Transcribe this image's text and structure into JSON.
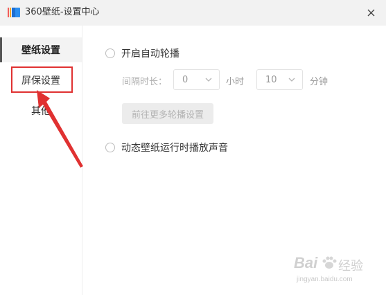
{
  "window": {
    "title": "360壁纸-设置中心"
  },
  "sidebar": {
    "items": [
      {
        "label": "壁纸设置",
        "active": true
      },
      {
        "label": "屏保设置",
        "active": false
      },
      {
        "label": "其他",
        "active": false
      }
    ]
  },
  "settings": {
    "auto_rotate": {
      "label": "开启自动轮播",
      "checked": false
    },
    "interval": {
      "label": "间隔时长：",
      "hours": {
        "value": "0",
        "unit": "小时"
      },
      "minutes": {
        "value": "10",
        "unit": "分钟"
      }
    },
    "more_rotate_button": "前往更多轮播设置",
    "dynamic_sound": {
      "label": "动态壁纸运行时播放声音",
      "checked": false
    }
  },
  "watermark": {
    "brand": "Bai",
    "brand_suffix": "经验",
    "url": "jingyan.baidu.com"
  },
  "colors": {
    "highlight": "#e03131",
    "arrow": "#e03131",
    "titlebar": "#f2f2f2"
  }
}
